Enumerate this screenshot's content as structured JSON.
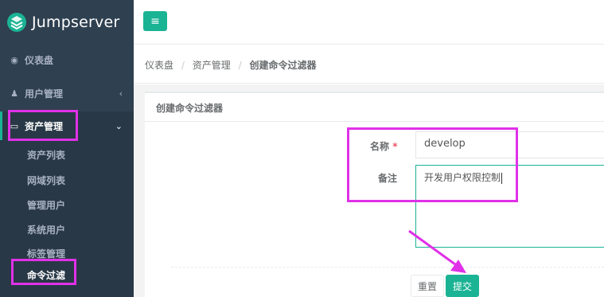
{
  "app": {
    "title": "Jumpserver"
  },
  "colors": {
    "accent": "#1ab394",
    "sidebar": "#2f4050",
    "highlight": "#e031e8"
  },
  "sidebar": {
    "items": [
      {
        "label": "仪表盘",
        "icon": "dashboard-icon"
      },
      {
        "label": "用户管理",
        "icon": "users-icon",
        "chevron": "‹"
      },
      {
        "label": "资产管理",
        "icon": "inbox-icon",
        "chevron": "⌄"
      }
    ],
    "submenu": [
      {
        "label": "资产列表"
      },
      {
        "label": "网域列表"
      },
      {
        "label": "管理用户"
      },
      {
        "label": "系统用户"
      },
      {
        "label": "标签管理"
      },
      {
        "label": "命令过滤"
      }
    ]
  },
  "topbar": {
    "menu_icon": "hamburger-icon",
    "menu_glyph": "≡"
  },
  "breadcrumb": {
    "items": [
      "仪表盘",
      "资产管理",
      "创建命令过滤器"
    ],
    "separator": "/"
  },
  "panel": {
    "title": "创建命令过滤器"
  },
  "form": {
    "name_label": "名称",
    "name_required": "*",
    "name_value": "develop",
    "comment_label": "备注",
    "comment_value": "开发用户权限控制",
    "reset_label": "重置",
    "submit_label": "提交"
  }
}
